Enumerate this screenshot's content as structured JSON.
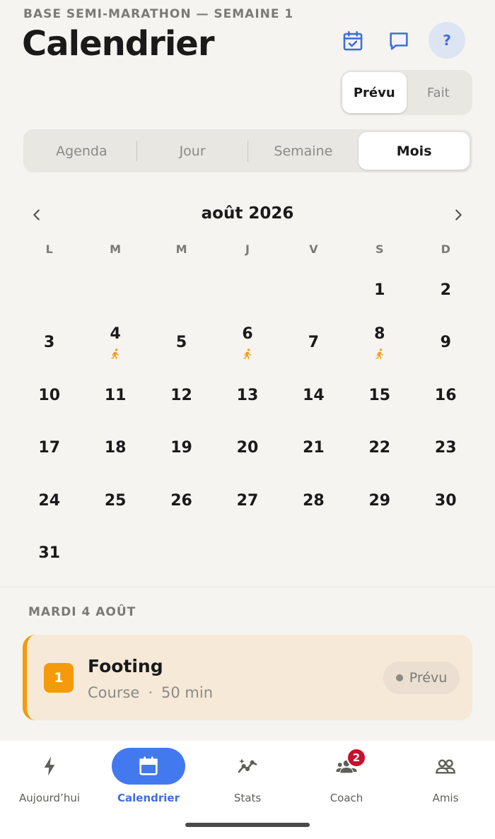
{
  "header": {
    "subtitle": "BASE SEMI-MARATHON — SEMAINE 1",
    "title": "Calendrier",
    "icons": [
      "calendar-check-icon",
      "chat-icon",
      "help-icon"
    ],
    "help_label": "?"
  },
  "status_toggle": {
    "options": [
      "Prévu",
      "Fait"
    ],
    "selected": "Prévu"
  },
  "view_tabs": {
    "options": [
      "Agenda",
      "Jour",
      "Semaine",
      "Mois"
    ],
    "selected": "Mois"
  },
  "calendar": {
    "month_label": "août 2026",
    "weekdays": [
      "L",
      "M",
      "M",
      "J",
      "V",
      "S",
      "D"
    ],
    "weeks": [
      [
        "",
        "",
        "",
        "",
        "",
        "1",
        "2"
      ],
      [
        "3",
        "4",
        "5",
        "6",
        "7",
        "8",
        "9"
      ],
      [
        "10",
        "11",
        "12",
        "13",
        "14",
        "15",
        "16"
      ],
      [
        "17",
        "18",
        "19",
        "20",
        "21",
        "22",
        "23"
      ],
      [
        "24",
        "25",
        "26",
        "27",
        "28",
        "29",
        "30"
      ],
      [
        "31",
        "",
        "",
        "",
        "",
        "",
        ""
      ]
    ],
    "workout_days": [
      "4",
      "6",
      "8"
    ]
  },
  "selected_day": {
    "label": "MARDI 4 AOÛT",
    "workout": {
      "number": "1",
      "title": "Footing",
      "type": "Course",
      "separator": "·",
      "duration": "50 min",
      "status": "Prévu"
    }
  },
  "bottom_nav": {
    "items": [
      {
        "label": "Aujourd’hui",
        "icon": "bolt-icon"
      },
      {
        "label": "Calendrier",
        "icon": "calendar-icon"
      },
      {
        "label": "Stats",
        "icon": "stats-icon"
      },
      {
        "label": "Coach",
        "icon": "coach-icon"
      },
      {
        "label": "Amis",
        "icon": "friends-icon"
      }
    ],
    "active": "Calendrier",
    "coach_badge": "2"
  },
  "colors": {
    "accent": "#4279ef",
    "workout": "#f59a0c",
    "badge": "#c8102e",
    "background": "#f5f4f0"
  }
}
